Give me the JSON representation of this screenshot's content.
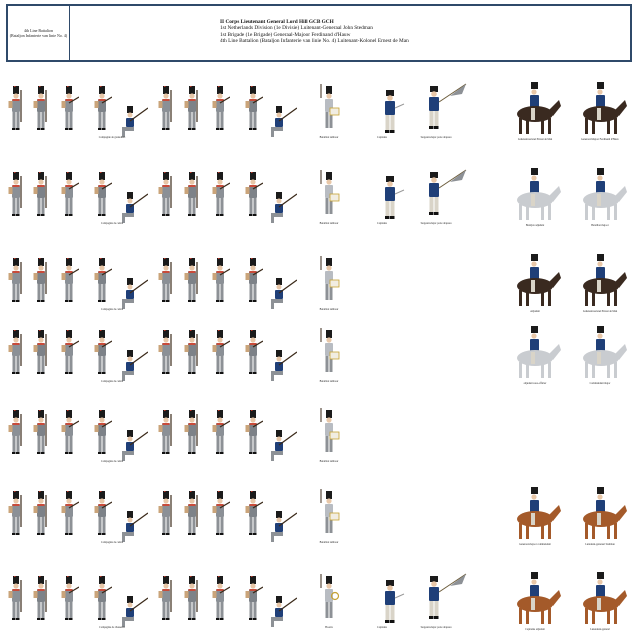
{
  "header": {
    "left_lines": [
      "4th Line Battalion",
      "(Bataljon Infanterie van linie No. 4)"
    ],
    "lines": [
      "II Corps Lieutenant General Lord Hill GCB GCH",
      "1st Netherlands Division (1e Divisie) Luitenant-Generaal John Stedman",
      "1st Brigade (1e Brigade) Generaal-Majoor Ferdinand d'Hauw",
      "4th Line Battalion (Bataljon Infanterie van linie No. 4) Luitenant-Kolonel Ernest de Man"
    ]
  },
  "rows": [
    {
      "company_label": "Compagnie de grenadiers",
      "musician_label": "Bataillon tambour",
      "officer_labels": [
        "Capitaine",
        "Sergeant-major porte drapeau"
      ],
      "mounted_labels": [
        "Luitenant-kolonel Ernest de Man",
        "Generaal-Majoor Ferdinand d'Hauw"
      ],
      "horse": "dark"
    },
    {
      "company_label": "Compagnie de centre",
      "musician_label": "Bataillon tambour",
      "officer_labels": [
        "Capitaine",
        "Sergeant-major porte drapeau"
      ],
      "mounted_labels": [
        "Bataljon adjudant",
        "Bataillon majoor"
      ],
      "horse": "grey"
    },
    {
      "company_label": "Compagnie de centre",
      "musician_label": "Bataillon tambour",
      "officer_labels": [],
      "mounted_labels": [
        "Adjudant",
        "Luitenant-kolonel Ernest de Man"
      ],
      "horse": "dark"
    },
    {
      "company_label": "Compagnie de centre",
      "musician_label": "Bataillon tambour",
      "officer_labels": [],
      "mounted_labels": [
        "adjudant sous-officier",
        "Commandant major"
      ],
      "horse": "grey"
    },
    {
      "company_label": "Compagnie de centre",
      "musician_label": "Bataillon tambour",
      "officer_labels": [],
      "mounted_labels": [],
      "horse": ""
    },
    {
      "company_label": "Compagnie de centre",
      "musician_label": "Bataillon tambour",
      "officer_labels": [],
      "mounted_labels": [
        "Generaal-majoor commandant",
        "Luitenant-generaal Stedman"
      ],
      "horse": "chestnut"
    },
    {
      "company_label": "Compagnie de chasseurs",
      "musician_label": "Hoorns",
      "officer_labels": [
        "Capitaine",
        "Sergeant-major porte drapeau"
      ],
      "mounted_labels": [
        "Capitaine adjudant",
        "Lieutenant-general"
      ],
      "horse": "chestnut"
    }
  ],
  "colors": {
    "header_border": "#2f4a6a",
    "grey_coat": "#7d8288",
    "officer_blue": "#1f3f78",
    "horse_dark": "#3a2a20",
    "horse_grey": "#c9ccd0",
    "horse_chestnut": "#a45a2a"
  },
  "icons": [
    "infantry-figure-icon",
    "kneeling-figure-icon",
    "musician-figure-icon",
    "officer-figure-icon",
    "horse-rider-icon"
  ]
}
